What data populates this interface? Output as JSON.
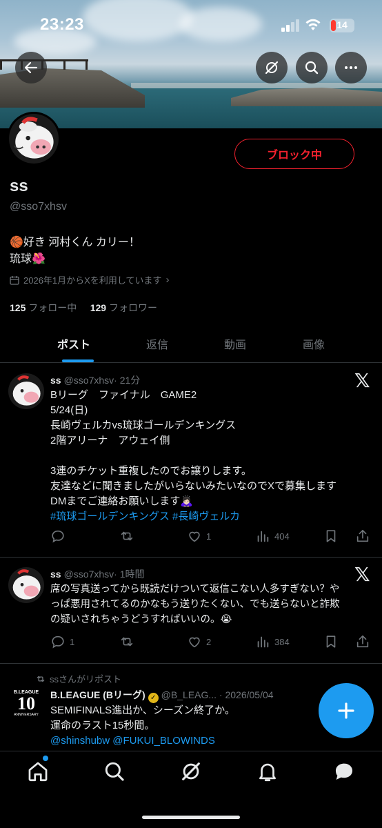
{
  "status_bar": {
    "time": "23:23",
    "battery": "14"
  },
  "profile": {
    "name": "ss",
    "handle": "@sso7xhsv",
    "bio_line1": "🏀好き 河村くん カリー！",
    "bio_line2": "琉球🌺",
    "joined": "2026年1月からXを利用しています",
    "following_count": "125",
    "following_label": "フォロー中",
    "followers_count": "129",
    "followers_label": "フォロワー",
    "block_button": "ブロック中"
  },
  "tabs": [
    {
      "label": "ポスト"
    },
    {
      "label": "返信"
    },
    {
      "label": "動画"
    },
    {
      "label": "画像"
    }
  ],
  "posts": [
    {
      "name": "ss",
      "handle": "@sso7xhsv",
      "time": "· 21分",
      "lines": [
        "Bリーグ　ファイナル　GAME2",
        "5/24(日)",
        "長崎ヴェルカvs琉球ゴールデンキングス",
        "2階アリーナ　アウェイ側",
        "",
        "3連のチケット重複したのでお譲りします。",
        "友達などに聞きましたがいらないみたいなのでXで募集します",
        "DMまでご連絡お願いします🙇🏻‍♀️"
      ],
      "hashtags": "#琉球ゴールデンキングス #長崎ヴェルカ",
      "reply_count": "",
      "repost_count": "",
      "like_count": "1",
      "view_count": "404"
    },
    {
      "name": "ss",
      "handle": "@sso7xhsv",
      "time": "· 1時間",
      "lines": [
        "席の写真送ってから既読だけついて返信こない人多すぎない？や",
        "っぱ悪用されてるのかなもう送りたくない、でも送らないと詐欺",
        "の疑いされちゃうどうすればいいの。😭"
      ],
      "reply_count": "1",
      "repost_count": "",
      "like_count": "2",
      "view_count": "384"
    },
    {
      "repost_label": "ssさんがリポスト",
      "name": "B.LEAGUE (Bリーグ)",
      "handle": "@B_LEAG...",
      "time": "· 2026/05/04",
      "avatar_text": "B.LEAGUE",
      "avatar_big": "10",
      "avatar_small": "ANNIVERSARY",
      "lines": [
        "SEMIFINALS進出か、シーズン終了か。",
        "運命のラスト15秒間。"
      ],
      "mentions": "@shinshubw @FUKUI_BLOWINDS"
    }
  ],
  "colors": {
    "accent": "#1d9bf0",
    "danger": "#f4212e",
    "muted": "#71767b"
  }
}
